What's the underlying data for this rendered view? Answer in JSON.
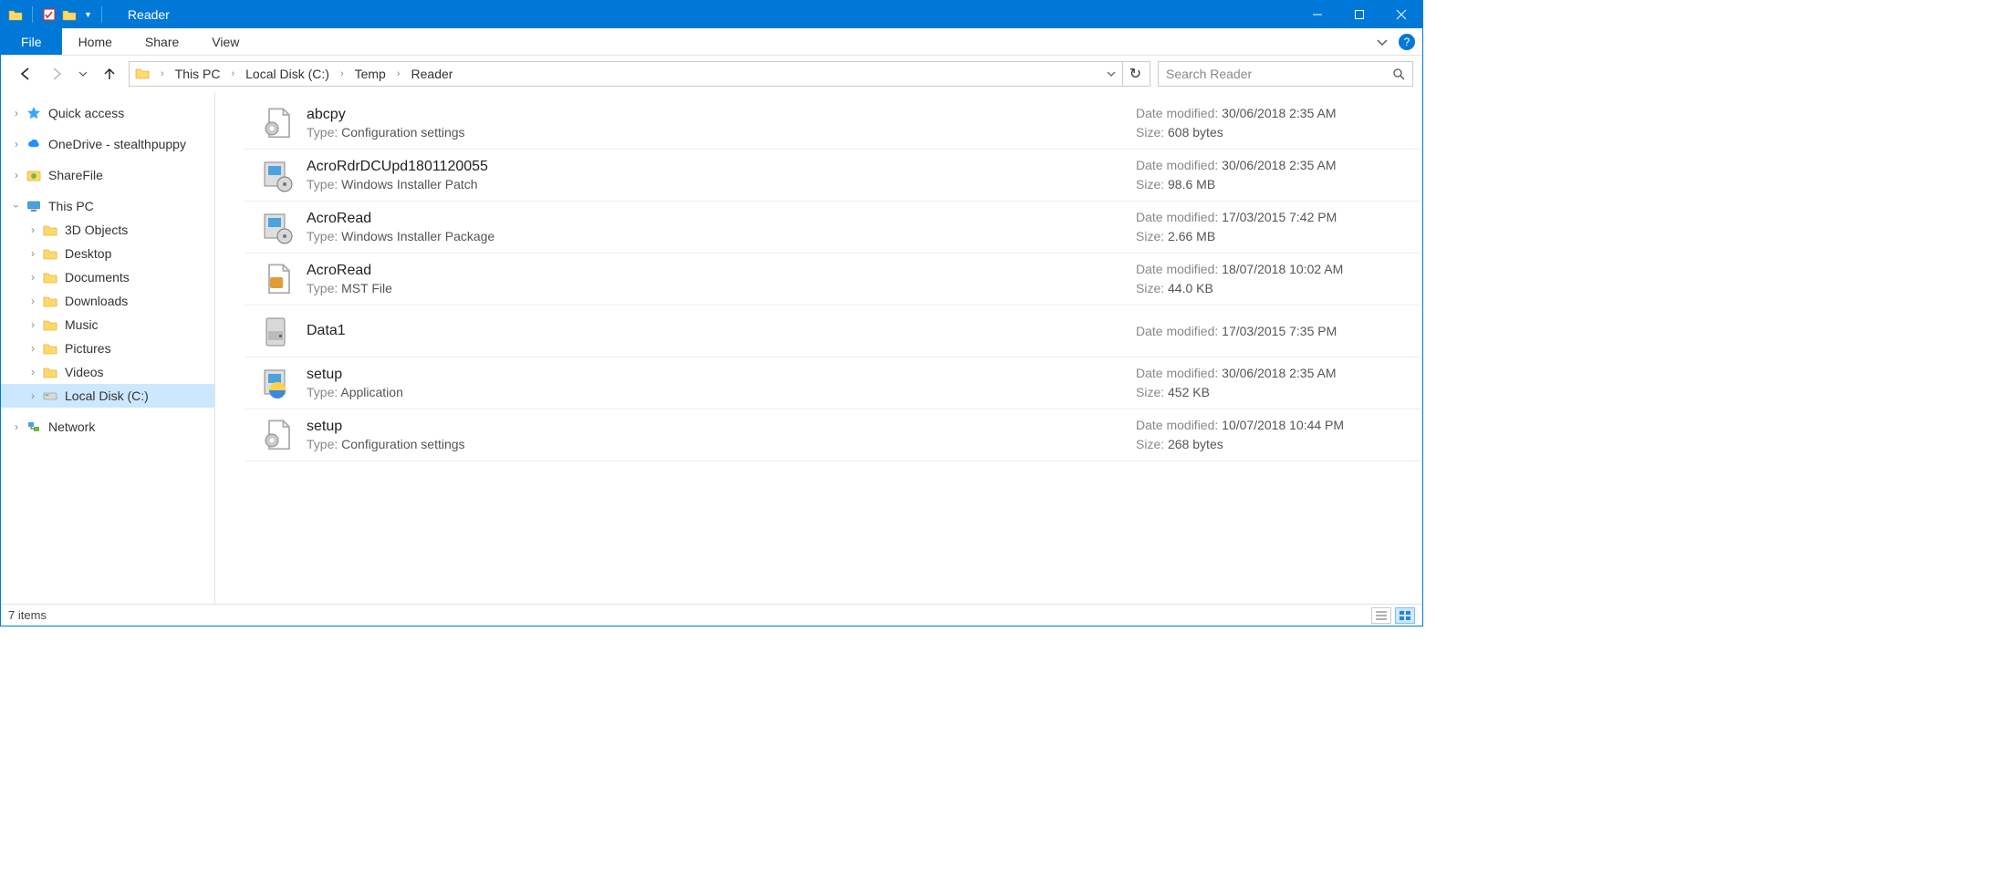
{
  "titlebar": {
    "title": "Reader"
  },
  "ribbon": {
    "file": "File",
    "tabs": [
      "Home",
      "Share",
      "View"
    ]
  },
  "breadcrumb": [
    "This PC",
    "Local Disk (C:)",
    "Temp",
    "Reader"
  ],
  "search": {
    "placeholder": "Search Reader"
  },
  "tree": {
    "quick_access": "Quick access",
    "onedrive": "OneDrive - stealthpuppy",
    "sharefile": "ShareFile",
    "this_pc": "This PC",
    "this_pc_children": [
      "3D Objects",
      "Desktop",
      "Documents",
      "Downloads",
      "Music",
      "Pictures",
      "Videos",
      "Local Disk (C:)"
    ],
    "network": "Network"
  },
  "labels": {
    "type": "Type:",
    "date_modified": "Date modified:",
    "size": "Size:"
  },
  "files": [
    {
      "name": "abcpy",
      "type": "Configuration settings",
      "date": "30/06/2018 2:35 AM",
      "size": "608 bytes",
      "icon": "config"
    },
    {
      "name": "AcroRdrDCUpd1801120055",
      "type": "Windows Installer Patch",
      "date": "30/06/2018 2:35 AM",
      "size": "98.6 MB",
      "icon": "msp"
    },
    {
      "name": "AcroRead",
      "type": "Windows Installer Package",
      "date": "17/03/2015 7:42 PM",
      "size": "2.66 MB",
      "icon": "msi"
    },
    {
      "name": "AcroRead",
      "type": "MST File",
      "date": "18/07/2018 10:02 AM",
      "size": "44.0 KB",
      "icon": "mst"
    },
    {
      "name": "Data1",
      "type": "",
      "date": "17/03/2015 7:35 PM",
      "size": "",
      "icon": "cab"
    },
    {
      "name": "setup",
      "type": "Application",
      "date": "30/06/2018 2:35 AM",
      "size": "452 KB",
      "icon": "exe"
    },
    {
      "name": "setup",
      "type": "Configuration settings",
      "date": "10/07/2018 10:44 PM",
      "size": "268 bytes",
      "icon": "config"
    }
  ],
  "status": {
    "item_count": "7 items"
  }
}
